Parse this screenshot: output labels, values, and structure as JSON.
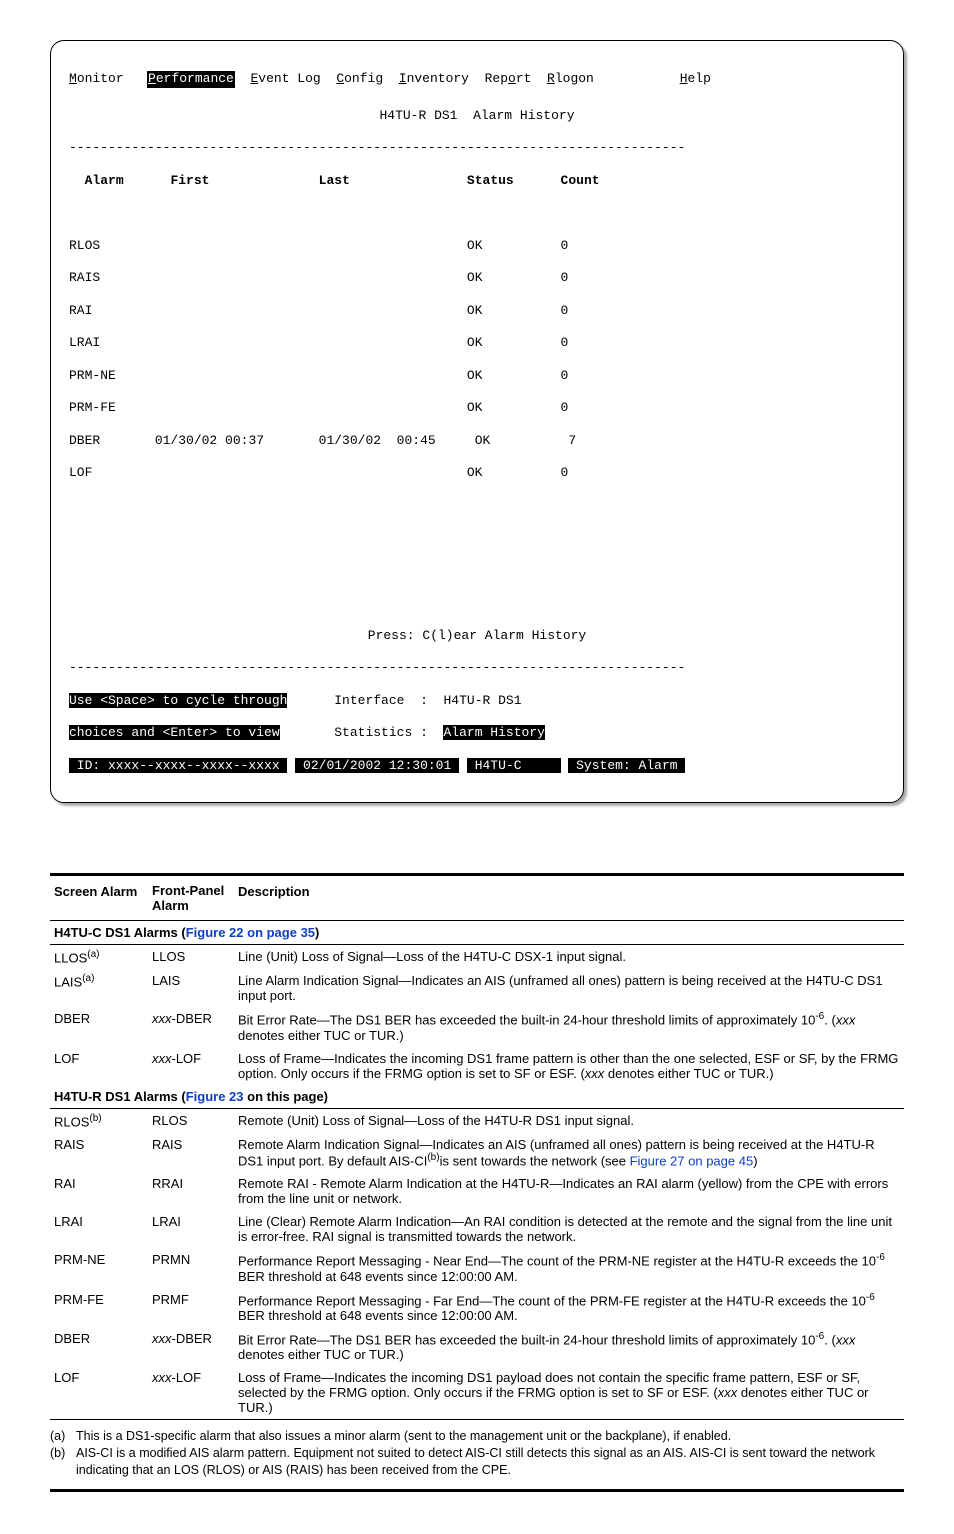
{
  "terminal": {
    "menu": {
      "monitor": "onitor",
      "performance": "erformance",
      "eventlog": "vent Log",
      "config": "onfig",
      "inventory": "nventory",
      "report": "Rep",
      "report2": "rt",
      "rlogon": "logon",
      "help": "elp"
    },
    "title": "H4TU-R DS1  Alarm History",
    "headers": {
      "alarm": "Alarm",
      "first": "First",
      "last": "Last",
      "status": "Status",
      "count": "Count"
    },
    "rows": [
      {
        "a": "RLOS",
        "f": "",
        "l": "",
        "s": "OK",
        "c": "0"
      },
      {
        "a": "RAIS",
        "f": "",
        "l": "",
        "s": "OK",
        "c": "0"
      },
      {
        "a": "RAI",
        "f": "",
        "l": "",
        "s": "OK",
        "c": "0"
      },
      {
        "a": "LRAI",
        "f": "",
        "l": "",
        "s": "OK",
        "c": "0"
      },
      {
        "a": "PRM-NE",
        "f": "",
        "l": "",
        "s": "OK",
        "c": "0"
      },
      {
        "a": "PRM-FE",
        "f": "",
        "l": "",
        "s": "OK",
        "c": "0"
      },
      {
        "a": "DBER",
        "f": "01/30/02 00:37",
        "l": "01/30/02  00:45",
        "s": "OK",
        "c": "7"
      },
      {
        "a": "LOF",
        "f": "",
        "l": "",
        "s": "OK",
        "c": "0"
      }
    ],
    "press": "Press: C(l)ear Alarm History",
    "hint1": "Use <Space> to cycle through",
    "hint2": "choices and <Enter> to view",
    "iface_lbl": "Interface  :",
    "iface_val": "H4TU-R DS1",
    "stats_lbl": "Statistics :",
    "stats_val": "Alarm History",
    "id_lbl": " ID: xxxx--xxxx--xxxx--xxxx ",
    "ts": " 02/01/2002 12:30:01 ",
    "node": " H4TU-C     ",
    "sys": " System: Alarm "
  },
  "table": {
    "h1": "Screen Alarm",
    "h2a": "Front-Panel",
    "h2b": "Alarm",
    "h3": "Description",
    "sec1a": "H4TU-C DS1 Alarms (",
    "sec1b": "Figure 22 on page 35",
    "sec1c": ")",
    "sec2a": "H4TU-R DS1 Alarms (",
    "sec2b": "Figure 23",
    "sec2c": " on this page)",
    "r": {
      "llos": {
        "sa": "LLOS",
        "sup": "(a)",
        "fp": "LLOS",
        "d": "Line (Unit) Loss of Signal—Loss of the H4TU-C DSX-1 input signal."
      },
      "lais": {
        "sa": "LAIS",
        "sup": "(a)",
        "fp": "LAIS",
        "d": "Line Alarm Indication Signal—Indicates an AIS (unframed all ones) pattern is being received at the H4TU-C DS1 input port."
      },
      "dber1": {
        "sa": "DBER",
        "fp_pre": "xxx",
        "fp": "-DBER",
        "d1": "Bit Error Rate—The DS1 BER has exceeded the built-in 24-hour threshold limits of approximately 10",
        "d_sup": "-6",
        "d2": ". (",
        "d_it": "xxx",
        "d3": " denotes either TUC or TUR.)"
      },
      "lof1": {
        "sa": "LOF",
        "fp_pre": "xxx",
        "fp": "-LOF",
        "d1": "Loss of Frame—Indicates the incoming DS1 frame pattern is other than the one selected, ESF or SF, by the FRMG option. Only occurs if the FRMG option is set to SF or ESF. (",
        "d_it": "xxx",
        "d2": " denotes either TUC or TUR.)"
      },
      "rlos": {
        "sa": "RLOS",
        "sup": "(b)",
        "fp": "RLOS",
        "d": "Remote (Unit) Loss of Signal—Loss of the H4TU-R DS1 input signal."
      },
      "rais": {
        "sa": "RAIS",
        "fp": "RAIS",
        "d1": "Remote Alarm Indication Signal—Indicates an AIS (unframed all ones) pattern is being received at the H4TU-R DS1 input port. By default AIS-CI",
        "d_sup": "(b)",
        "d2": "is sent towards the network (see ",
        "link": "Figure 27 on page 45",
        "d3": ")"
      },
      "rai": {
        "sa": "RAI",
        "fp": "RRAI",
        "d": "Remote RAI - Remote Alarm Indication at the H4TU-R—Indicates an RAI alarm (yellow) from the CPE with errors from the line unit or network."
      },
      "lrai": {
        "sa": "LRAI",
        "fp": "LRAI",
        "d": "Line (Clear) Remote Alarm Indication—An RAI condition is detected at the remote and the signal from the line unit is error-free. RAI signal is transmitted towards the network."
      },
      "prmne": {
        "sa": "PRM-NE",
        "fp": "PRMN",
        "d1": "Performance Report Messaging - Near End—The count of the PRM-NE register at the H4TU-R exceeds the 10",
        "d_sup": "-6",
        "d2": " BER threshold at 648 events since 12:00:00 AM."
      },
      "prmfe": {
        "sa": "PRM-FE",
        "fp": "PRMF",
        "d1": "Performance Report Messaging - Far End—The count of the PRM-FE register at the H4TU-R exceeds the 10",
        "d_sup": "-6",
        "d2": " BER threshold at 648 events since 12:00:00 AM."
      },
      "dber2": {
        "sa": "DBER",
        "fp_pre": "xxx",
        "fp": "-DBER",
        "d1": "Bit Error Rate—The DS1 BER has exceeded the built-in 24-hour threshold limits of approximately 10",
        "d_sup": "-6",
        "d2": ". (",
        "d_it": "xxx",
        "d3": " denotes either TUC or TUR.)"
      },
      "lof2": {
        "sa": "LOF",
        "fp_pre": "xxx",
        "fp": "-LOF",
        "d1": "Loss of Frame—Indicates the incoming DS1 payload does not contain the specific frame pattern, ESF or SF, selected by the FRMG option. Only occurs if the FRMG option is set to SF or ESF. (",
        "d_it": "xxx",
        "d2": " denotes either TUC or TUR.)"
      }
    },
    "fn_a_tag": "(a)",
    "fn_a": "This is a DS1-specific alarm that also issues a minor alarm (sent to the management unit or the backplane), if enabled.",
    "fn_b_tag": "(b)",
    "fn_b": "AIS-CI is a modified AIS alarm pattern. Equipment not suited to detect AIS-CI still detects this signal as an AIS. AIS-CI is sent toward the network indicating that an LOS (RLOS) or AIS (RAIS) has been received from the CPE."
  }
}
